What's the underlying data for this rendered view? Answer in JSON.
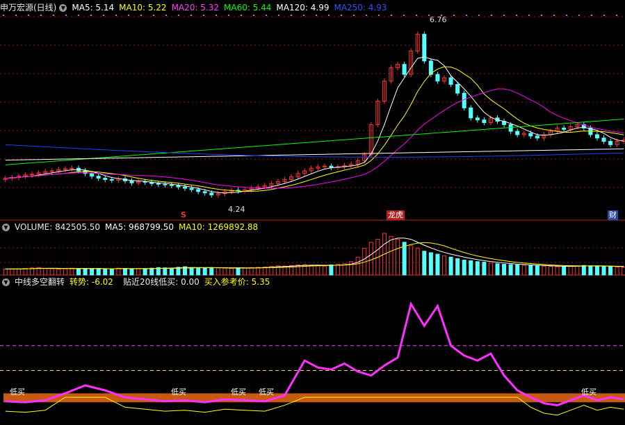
{
  "colors": {
    "bg": "#000000",
    "up": "#ff3232",
    "down": "#54ffff",
    "ma5": "#ffffff",
    "ma10": "#ffff00",
    "ma20": "#ff00ff",
    "ma60": "#00ff00",
    "ma120": "#ffffff",
    "ma250": "#2040ff",
    "grid": "#8b1a1a",
    "osc": "#ff30ff",
    "oscThin": "#ffff00",
    "band": "#c65a10"
  },
  "icons": {
    "panel_toggle": "chevron-down-icon"
  },
  "price_panel": {
    "title": "申万宏源(日线)",
    "ma5": "MA5: 5.14",
    "ma10": "MA10: 5.22",
    "ma20": "MA20: 5.32",
    "ma60": "MA60: 5.44",
    "ma120": "MA120: 4.99",
    "ma250": "MA250: 4.93",
    "high_label": "6.76",
    "low_label": "4.24",
    "tag_s": "S",
    "tag_lhb": "龙虎",
    "tag_cai": "财"
  },
  "volume_panel": {
    "volume": "VOLUME: 842505.50",
    "ma5": "MA5: 968799.50",
    "ma10": "MA10: 1269892.88"
  },
  "indicator_panel": {
    "title": "中线多空翻转",
    "trend": "转势: -6.02",
    "near20": "贴近20线低买: 0.00",
    "buy_ref": "买入参考价: 5.35",
    "signal_label": "低买"
  },
  "chart_data": [
    {
      "type": "candlestick",
      "title": "申万宏源(日线)",
      "ylim": [
        4.1,
        6.9
      ],
      "close": [
        4.55,
        4.56,
        4.58,
        4.6,
        4.61,
        4.63,
        4.65,
        4.66,
        4.68,
        4.69,
        4.7,
        4.66,
        4.62,
        4.58,
        4.55,
        4.53,
        4.52,
        4.54,
        4.51,
        4.48,
        4.5,
        4.49,
        4.47,
        4.46,
        4.45,
        4.44,
        4.42,
        4.4,
        4.38,
        4.35,
        4.33,
        4.3,
        4.32,
        4.35,
        4.37,
        4.36,
        4.38,
        4.4,
        4.42,
        4.44,
        4.47,
        4.5,
        4.53,
        4.57,
        4.62,
        4.66,
        4.7,
        4.72,
        4.73,
        4.71,
        4.72,
        4.74,
        4.76,
        4.81,
        4.9,
        5.35,
        5.7,
        6.0,
        6.2,
        6.25,
        6.1,
        6.45,
        6.7,
        6.3,
        6.1,
        6.0,
        6.05,
        5.95,
        5.82,
        5.6,
        5.45,
        5.42,
        5.38,
        5.45,
        5.4,
        5.35,
        5.25,
        5.2,
        5.22,
        5.18,
        5.15,
        5.2,
        5.25,
        5.3,
        5.28,
        5.32,
        5.35,
        5.3,
        5.2,
        5.15,
        5.1,
        5.05,
        5.1,
        5.12
      ],
      "ma_values": {
        "MA5": 5.14,
        "MA10": 5.22,
        "MA20": 5.32,
        "MA60": 5.44,
        "MA120": 4.99,
        "MA250": 4.93
      },
      "annotations": [
        "6.76",
        "4.24",
        "S",
        "龙虎",
        "财"
      ]
    },
    {
      "type": "bar",
      "title": "VOLUME",
      "values": [
        2,
        2.1,
        2,
        2.2,
        2.4,
        2.5,
        2.2,
        2.1,
        2,
        2.1,
        2.3,
        2.2,
        2.1,
        2,
        2.2,
        2.1,
        2,
        2.3,
        2.2,
        2,
        2.2,
        2.1,
        2.3,
        2.5,
        2.4,
        2.3,
        2.6,
        2.8,
        2.5,
        2.4,
        2.3,
        2.5,
        2.4,
        2.3,
        2.2,
        2.4,
        2.3,
        2.5,
        2.6,
        2.7,
        2.9,
        3.1,
        3,
        3.2,
        3.4,
        3.5,
        3.3,
        3.2,
        3,
        3.4,
        3.6,
        3.8,
        4.5,
        6,
        9,
        11,
        12,
        14,
        13,
        12,
        11,
        10,
        9,
        8,
        7.5,
        7,
        6.5,
        6,
        5.5,
        5,
        4.8,
        4.5,
        4.3,
        4,
        3.8,
        3.6,
        3.5,
        3.4,
        3.3,
        3.2,
        3.1,
        3,
        2.9,
        2.8,
        2.9,
        3,
        3.1,
        3.2,
        3.1,
        3,
        2.9,
        2.8,
        2.7,
        2.6
      ],
      "legend": [
        "VOLUME: 842505.50",
        "MA5: 968799.50",
        "MA10: 1269892.88"
      ]
    },
    {
      "type": "line",
      "title": "中线多空翻转",
      "x": [
        0,
        3,
        6,
        9,
        12,
        15,
        18,
        21,
        24,
        27,
        30,
        33,
        36,
        39,
        42,
        45,
        47,
        49,
        51,
        53,
        55,
        57,
        59,
        61,
        63,
        65,
        67,
        69,
        71,
        73,
        75,
        77,
        79,
        81,
        83,
        85,
        87,
        89,
        91,
        93
      ],
      "series": [
        {
          "name": "转势",
          "values": [
            14,
            13,
            15,
            22,
            30,
            25,
            18,
            16,
            14,
            15,
            13,
            16,
            15,
            14,
            20,
            55,
            48,
            46,
            52,
            44,
            40,
            50,
            58,
            112,
            90,
            110,
            70,
            60,
            55,
            62,
            40,
            25,
            18,
            12,
            10,
            15,
            20,
            15,
            18,
            16
          ]
        }
      ],
      "ylim": [
        -5,
        130
      ],
      "reference_lines": [
        70,
        45
      ]
    }
  ]
}
